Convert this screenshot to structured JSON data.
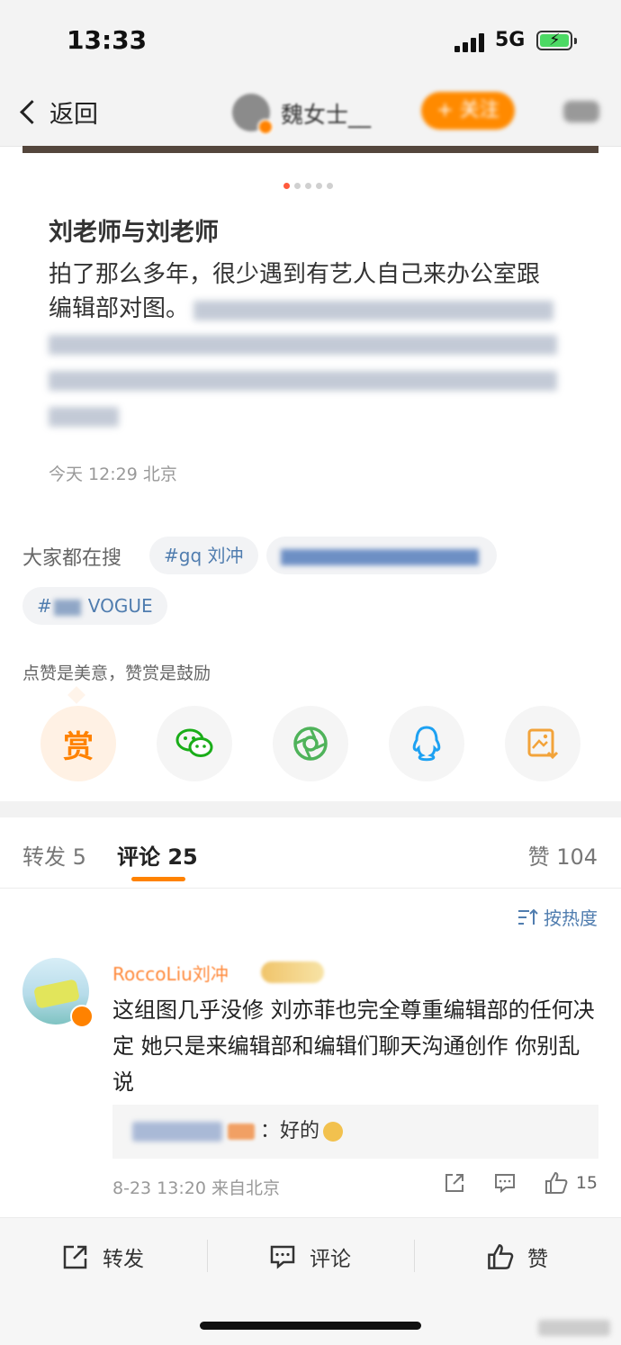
{
  "status_bar": {
    "time": "13:33",
    "network": "5G"
  },
  "nav": {
    "back_label": "返回",
    "user_name": "魏女士__",
    "follow_label": "+ 关注"
  },
  "post": {
    "title": "刘老师与刘老师",
    "body_line1": "拍了那么多年，很少遇到有艺人自己来办公室跟",
    "body_line2_visible": "编辑部对图。",
    "meta": "今天 12:29 北京"
  },
  "search": {
    "label": "大家都在搜",
    "tags": [
      "#gq 刘冲",
      "VOGUE"
    ],
    "tag2_prefix": "#"
  },
  "reward": {
    "hint": "点赞是美意，赞赏是鼓励",
    "button_label": "赏"
  },
  "tabs": {
    "repost": "转发 5",
    "comments": "评论 25",
    "likes": "赞 104"
  },
  "sort_label": "按热度",
  "comment": {
    "author": "RoccoLiu刘冲",
    "text": "这组图几乎没修 刘亦菲也完全尊重编辑部的任何决定 她只是来编辑部和编辑们聊天沟通创作 你别乱说",
    "reply_text": "：好的",
    "meta": "8-23 13:20 来自北京",
    "like_count": "15"
  },
  "bottom_bar": {
    "repost": "转发",
    "comment": "评论",
    "like": "赞"
  },
  "colors": {
    "accent": "#ff8200",
    "link": "#507daf"
  }
}
